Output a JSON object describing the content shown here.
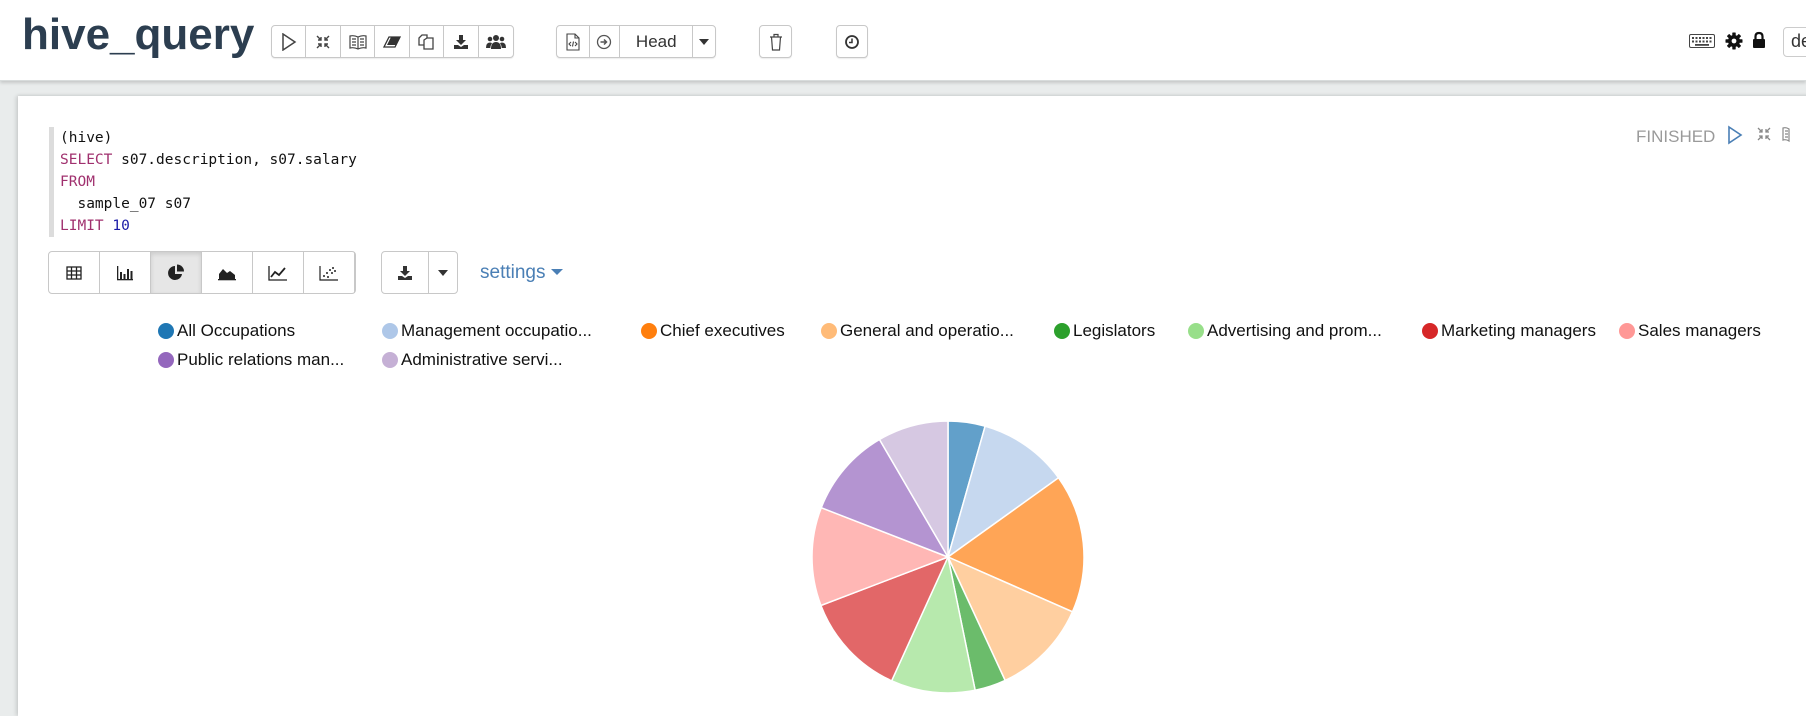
{
  "header": {
    "title": "hive_query",
    "head_label": "Head",
    "database_value": "default",
    "toolbar_icons": [
      "run-icon",
      "collapse-icon",
      "book-icon",
      "eraser-icon",
      "clone-icon",
      "download-icon",
      "users-icon"
    ],
    "group2_icons": [
      "code-file-icon",
      "arrow-circle-icon",
      "head-dropdown",
      "caret-down-icon"
    ],
    "right_icons": [
      "keyboard-icon",
      "gear-icon",
      "lock-icon"
    ]
  },
  "paragraph": {
    "status": "FINISHED",
    "code": {
      "interpreter": "(hive)",
      "select_kw": "SELECT",
      "select_cols": " s07.description, s07.salary",
      "from_kw": "FROM",
      "table": "  sample_07 s07",
      "limit_kw": "LIMIT",
      "limit_val": "10"
    },
    "chart_types": [
      "table",
      "bar",
      "pie",
      "area",
      "line",
      "scatter"
    ],
    "active_chart_type": "pie",
    "settings_label": "settings"
  },
  "chart_data": {
    "type": "pie",
    "title": "",
    "legend_position": "top",
    "categories": [
      "All Occupations",
      "Management occupatio...",
      "Chief executives",
      "General and operatio...",
      "Legislators",
      "Advertising and prom...",
      "Marketing managers",
      "Sales managers",
      "Public relations man...",
      "Administrative servi..."
    ],
    "values_percent": [
      4.4,
      10.7,
      16.5,
      11.5,
      3.7,
      10.0,
      12.4,
      11.7,
      10.7,
      8.4
    ],
    "colors": [
      "#1f77b4",
      "#aec7e8",
      "#ff7f0e",
      "#ffbb78",
      "#2ca02c",
      "#98df8a",
      "#d62728",
      "#ff9896",
      "#9467bd",
      "#c5b0d5"
    ]
  }
}
